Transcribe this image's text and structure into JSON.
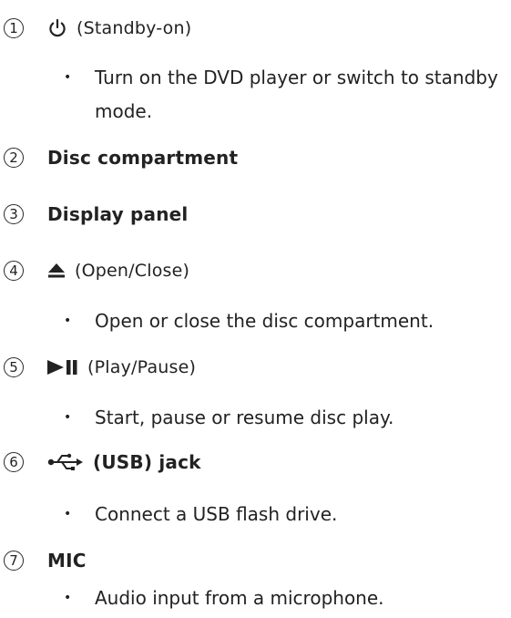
{
  "items": [
    {
      "number": "1",
      "icon": "standby-power-icon",
      "label": "(Standby-on)",
      "bullets": [
        "Turn on the DVD player or switch to standby mode."
      ]
    },
    {
      "number": "2",
      "icon": null,
      "label": "Disc compartment",
      "bullets": []
    },
    {
      "number": "3",
      "icon": null,
      "label": "Display panel",
      "bullets": []
    },
    {
      "number": "4",
      "icon": "eject-icon",
      "label": "(Open/Close)",
      "bullets": [
        "Open or close the disc compartment."
      ]
    },
    {
      "number": "5",
      "icon": "play-pause-icon",
      "label": "(Play/Pause)",
      "bullets": [
        "Start, pause or resume disc play."
      ]
    },
    {
      "number": "6",
      "icon": "usb-icon",
      "label": "(USB) jack",
      "bullets": [
        "Connect a USB flash drive."
      ]
    },
    {
      "number": "7",
      "icon": null,
      "label": "MIC",
      "bullets": [
        "Audio input from a microphone."
      ]
    }
  ],
  "bullet_symbol": "•"
}
